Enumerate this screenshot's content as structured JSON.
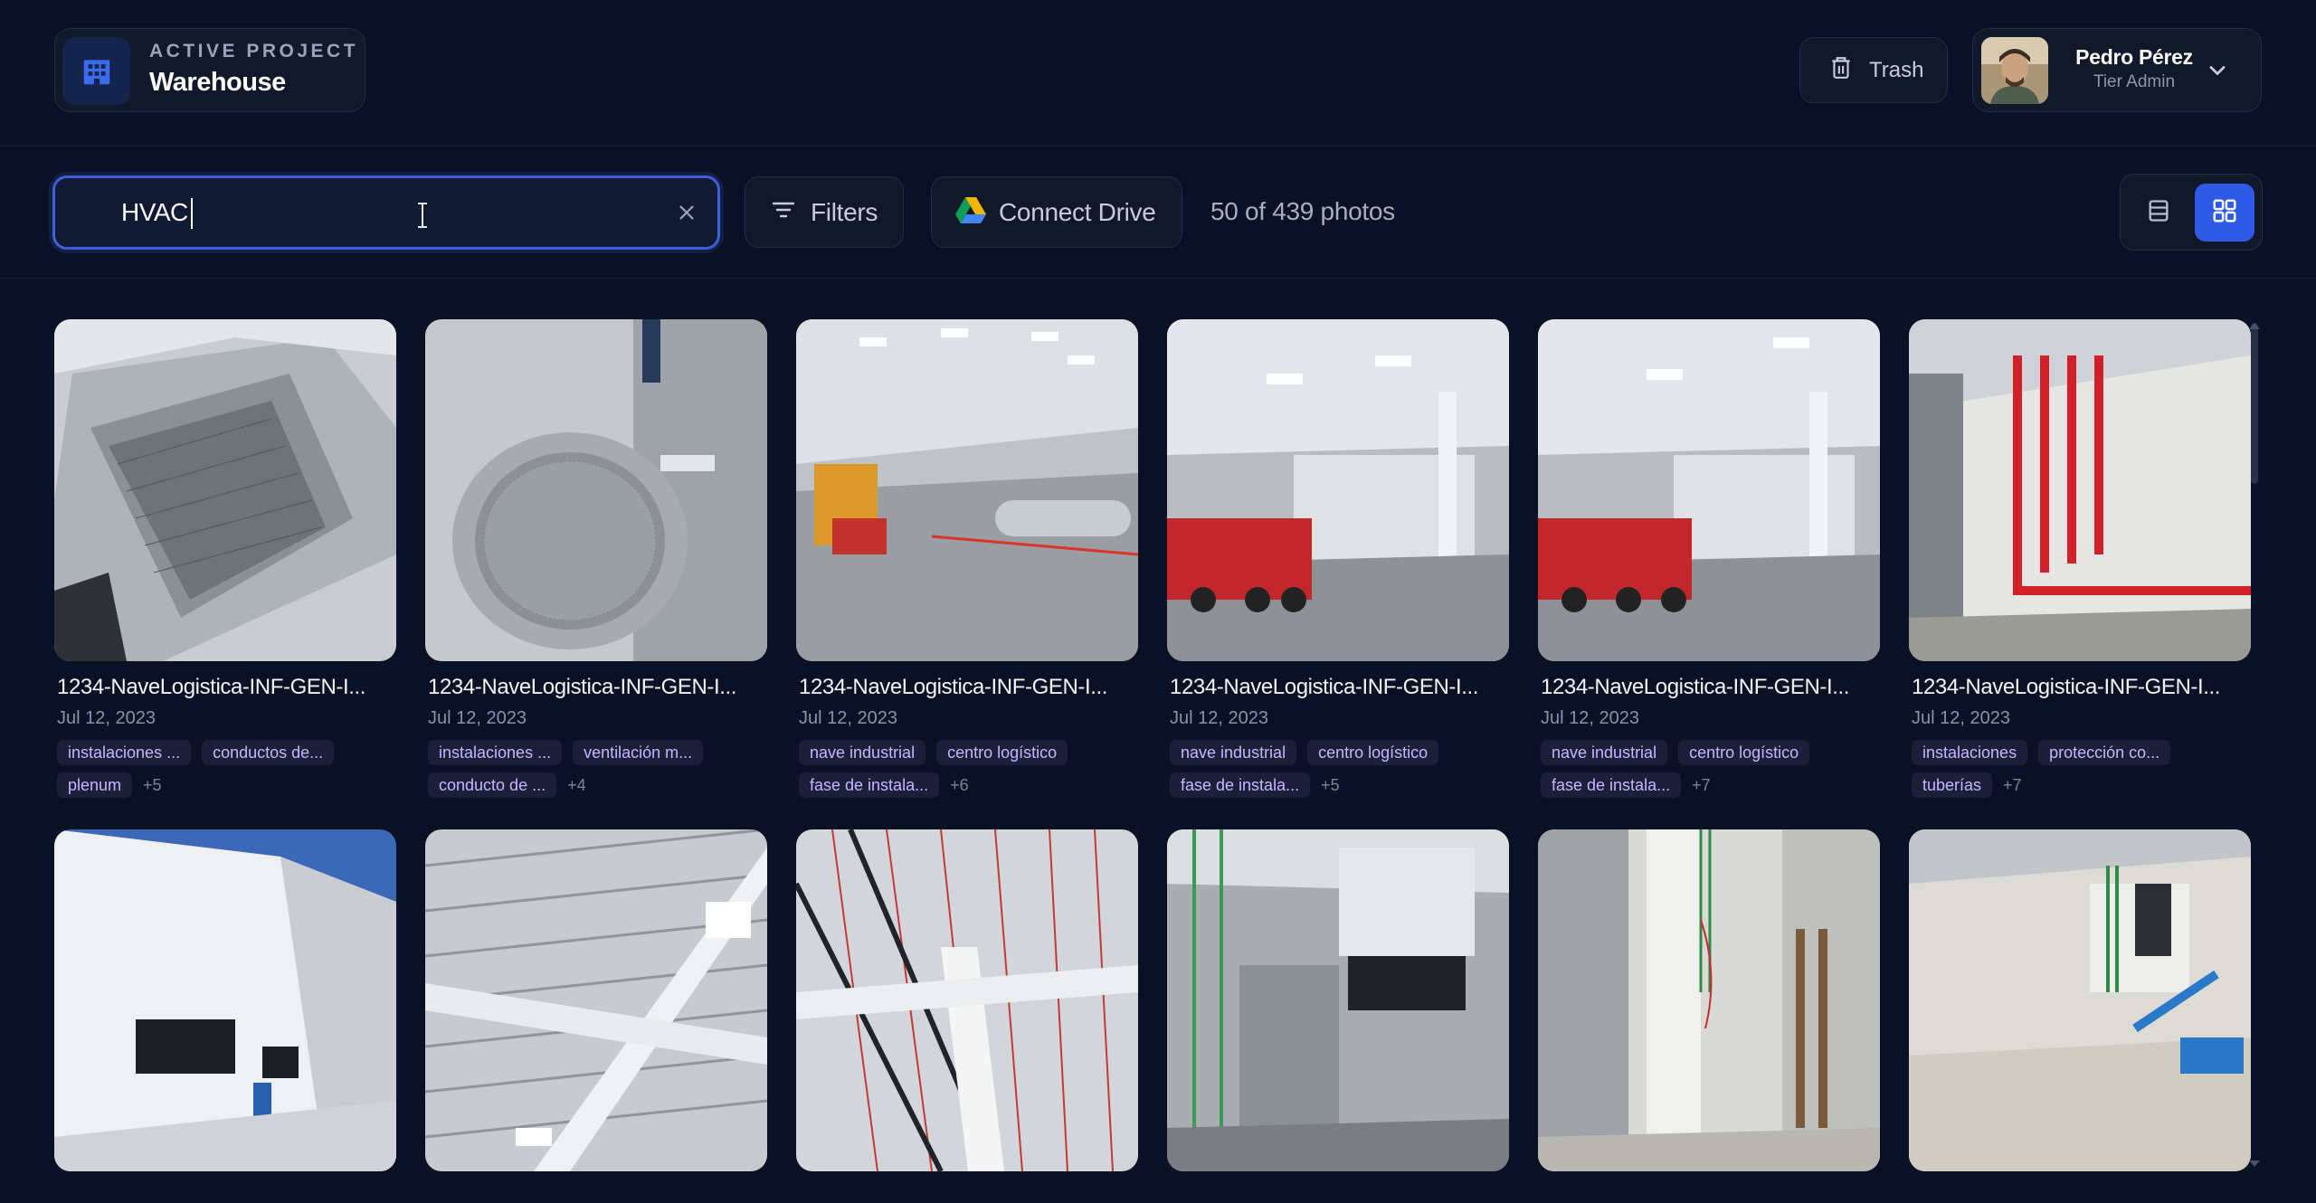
{
  "header": {
    "project": {
      "kicker": "ACTIVE PROJECT",
      "name": "Warehouse",
      "icon": "building-icon"
    },
    "trash": {
      "label": "Trash",
      "icon": "trash-icon"
    },
    "user": {
      "name": "Pedro Pérez",
      "role": "Tier Admin",
      "menu_icon": "chevron-down-icon"
    }
  },
  "toolbar": {
    "search": {
      "value": "HVAC",
      "clear_icon": "close-icon"
    },
    "filters": {
      "label": "Filters",
      "icon": "filter-icon"
    },
    "drive": {
      "label": "Connect Drive",
      "icon": "google-drive-icon"
    },
    "count": "50 of 439 photos",
    "view": {
      "selected": "grid",
      "options": [
        "list",
        "grid"
      ]
    }
  },
  "colors": {
    "accent": "#2f5ae8",
    "background": "#0b1124",
    "tag_bg": "#1b1f3a",
    "tag_text": "#c8b5ff"
  },
  "photos": [
    {
      "title": "1234-NaveLogistica-INF-GEN-I...",
      "date": "Jul 12, 2023",
      "tags": [
        "instalaciones ...",
        "conductos de...",
        "plenum"
      ],
      "more": "+5"
    },
    {
      "title": "1234-NaveLogistica-INF-GEN-I...",
      "date": "Jul 12, 2023",
      "tags": [
        "instalaciones ...",
        "ventilación m...",
        "conducto de ..."
      ],
      "more": "+4"
    },
    {
      "title": "1234-NaveLogistica-INF-GEN-I...",
      "date": "Jul 12, 2023",
      "tags": [
        "nave industrial",
        "centro logístico",
        "fase de instala..."
      ],
      "more": "+6"
    },
    {
      "title": "1234-NaveLogistica-INF-GEN-I...",
      "date": "Jul 12, 2023",
      "tags": [
        "nave industrial",
        "centro logístico",
        "fase de instala..."
      ],
      "more": "+5"
    },
    {
      "title": "1234-NaveLogistica-INF-GEN-I...",
      "date": "Jul 12, 2023",
      "tags": [
        "nave industrial",
        "centro logístico",
        "fase de instala..."
      ],
      "more": "+7"
    },
    {
      "title": "1234-NaveLogistica-INF-GEN-I...",
      "date": "Jul 12, 2023",
      "tags": [
        "instalaciones",
        "protección co...",
        "tuberías"
      ],
      "more": "+7"
    },
    {
      "title": "",
      "date": "",
      "tags": [],
      "more": ""
    },
    {
      "title": "",
      "date": "",
      "tags": [],
      "more": ""
    },
    {
      "title": "",
      "date": "",
      "tags": [],
      "more": ""
    },
    {
      "title": "",
      "date": "",
      "tags": [],
      "more": ""
    },
    {
      "title": "",
      "date": "",
      "tags": [],
      "more": ""
    },
    {
      "title": "",
      "date": "",
      "tags": [],
      "more": ""
    }
  ]
}
